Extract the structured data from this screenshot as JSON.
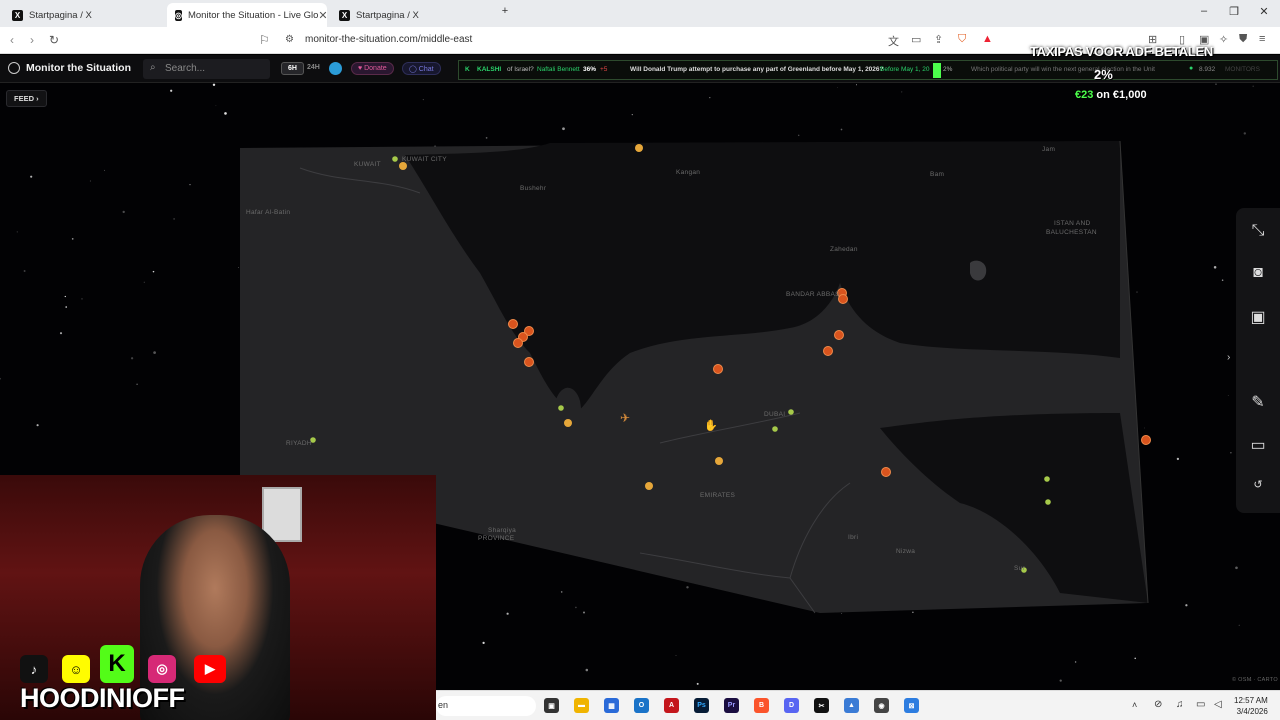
{
  "browser": {
    "tabs": [
      {
        "label": "Startpagina / X",
        "active": false
      },
      {
        "label": "Monitor the Situation - Live Glo",
        "active": true
      },
      {
        "label": "Startpagina / X",
        "active": false
      }
    ],
    "new_tab_icon": "plus-icon",
    "url": "monitor-the-situation.com/middle-east"
  },
  "site": {
    "brand": "Monitor the Situation",
    "search_placeholder": "Search...",
    "time_filters": [
      "6H",
      "24H"
    ],
    "donate_label": "Donate",
    "chat_label": "Chat",
    "feed_label": "FEED"
  },
  "ticker": {
    "source": "KALSHI",
    "item1_text": "of Israel?",
    "item1_name": "Naftali Bennett",
    "item1_pct": "36%",
    "item1_change": "+5",
    "item2_text": "Will Donald Trump attempt to purchase any part of Greenland before May 1, 2026?",
    "item2_detail": "Before May 1, 20",
    "item2_pct": "2%",
    "item3_text": "Which political party will win the next general election in the Unit",
    "monitors_count": "8.932",
    "monitors_label": "MONITORS"
  },
  "stream_overlay": {
    "title": "TAXIPAS VOOR ADF BETALEN",
    "percent": "2%",
    "bet_amount": "€23",
    "bet_total": "on €1,000",
    "streamer": "HOODINIOFF"
  },
  "map": {
    "labels": [
      {
        "text": "KUWAIT",
        "id": "kuwait"
      },
      {
        "text": "KUWAIT CITY",
        "id": "kuwait-city"
      },
      {
        "text": "Hafar Al-Batin",
        "id": "hafar"
      },
      {
        "text": "Bushehr",
        "id": "bushehr"
      },
      {
        "text": "Kangan",
        "id": "kangan"
      },
      {
        "text": "Jam",
        "id": "jam"
      },
      {
        "text": "Bam",
        "id": "bam"
      },
      {
        "text": "Zahedan",
        "id": "zahedan"
      },
      {
        "text": "ISTAN AND",
        "id": "sistan1"
      },
      {
        "text": "BALUCHESTAN",
        "id": "sistan2"
      },
      {
        "text": "BANDAR ABBAS",
        "id": "bandar"
      },
      {
        "text": "RIYADH",
        "id": "riyadh"
      },
      {
        "text": "DUBAI",
        "id": "dubai"
      },
      {
        "text": "EMIRATES",
        "id": "emirates"
      },
      {
        "text": "Sharqiya",
        "id": "sharqiya"
      },
      {
        "text": "PROVINCE",
        "id": "province"
      },
      {
        "text": "Nizwa",
        "id": "nizwa"
      },
      {
        "text": "Ibri",
        "id": "ibri"
      },
      {
        "text": "Sur",
        "id": "sur"
      }
    ],
    "attribution": "© OSM · CARTO"
  },
  "taskbar": {
    "search_text": "en",
    "time": "12:57 AM",
    "date": "3/4/2026"
  },
  "colors": {
    "fire": "#d9541e",
    "event_yellow": "#e6a73a",
    "event_green": "#a6c94a",
    "ticker_green": "#2bd36b"
  }
}
